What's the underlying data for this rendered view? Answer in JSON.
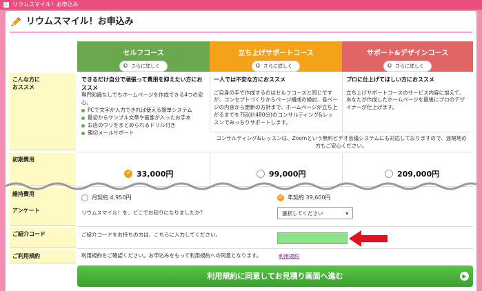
{
  "window": {
    "title": "リウムスマイル！お申込み"
  },
  "page": {
    "heading": "リウムスマイル！お申込み"
  },
  "courses": [
    {
      "name": "セルフコース",
      "more": "さらに詳しく",
      "color": "#6aa84f"
    },
    {
      "name": "立ち上げサポートコース",
      "more": "さらに詳しく",
      "color": "#f4a21a"
    },
    {
      "name": "サポート&デザインコース",
      "more": "さらに詳しく",
      "color": "#e06666"
    }
  ],
  "rows": {
    "recommend_label": "こんな方に\nおススメ",
    "initial_label": "初期費用",
    "maintenance_label": "維持費用",
    "survey_label": "アンケート",
    "referral_label": "ご紹介コード",
    "terms_label": "ご利用規約"
  },
  "recommend": {
    "self_title": "できるだけ自分で頑張って費用を抑えたい方におススメ",
    "self_desc": "専門知識なしでもホームページを作成できる4つの安心。",
    "self_bullets": [
      "PCで文字が入力できれば使える簡単システム",
      "最初からサンプル文章や画像が入ったお手本",
      "お店のウリをまとめられるドリル付き",
      "親切メールサポート"
    ],
    "launch_title": "一人では不安な方におススメ",
    "launch_desc": "ご自身の手で作成するのはセルフコースと同じですが、コンセプトづくりからページ構成の検討、各ページの内容から更新の方針まで、ホームページが立ち上がるまでを7回(計480分)のコンサルティング&レッスンでみっちりサポートします。",
    "design_title": "プロに仕上げてほしい方におススメ",
    "design_desc": "立ち上げサポートコースのサービス内容に加えて、あなたが作成したホームページを最後にプロのデザイナーが仕上げます。",
    "zoom_note": "コンサルティング&レッスンは、Zoomという無料ビデオ会議システムにも対応しておりますので、遠隔地の方もご安心ください。"
  },
  "initial": [
    {
      "price": "33,000円",
      "selected": true
    },
    {
      "price": "99,000円",
      "selected": false
    },
    {
      "price": "209,000円",
      "selected": false
    }
  ],
  "maintenance": [
    {
      "label": "月契約 4,950円",
      "selected": false
    },
    {
      "label": "年契約 39,600円",
      "selected": true
    }
  ],
  "survey": {
    "question": "リウムスマイル！を、どこでお知りになりましたか？",
    "select_value": "選択してください"
  },
  "referral": {
    "prompt": "ご紹介コードをお持ちの方は、こちらに入力してください。",
    "value": ""
  },
  "terms": {
    "text": "利用規約をご確認ください。お申込みをもって利用規約への同意となります。",
    "link": "利用規約"
  },
  "submit_label": "利用規約に同意してお見積り画面へ進む",
  "colors": {
    "accent": "#e9507f",
    "arrow": "#e3101d",
    "input": "#8ee08a"
  }
}
